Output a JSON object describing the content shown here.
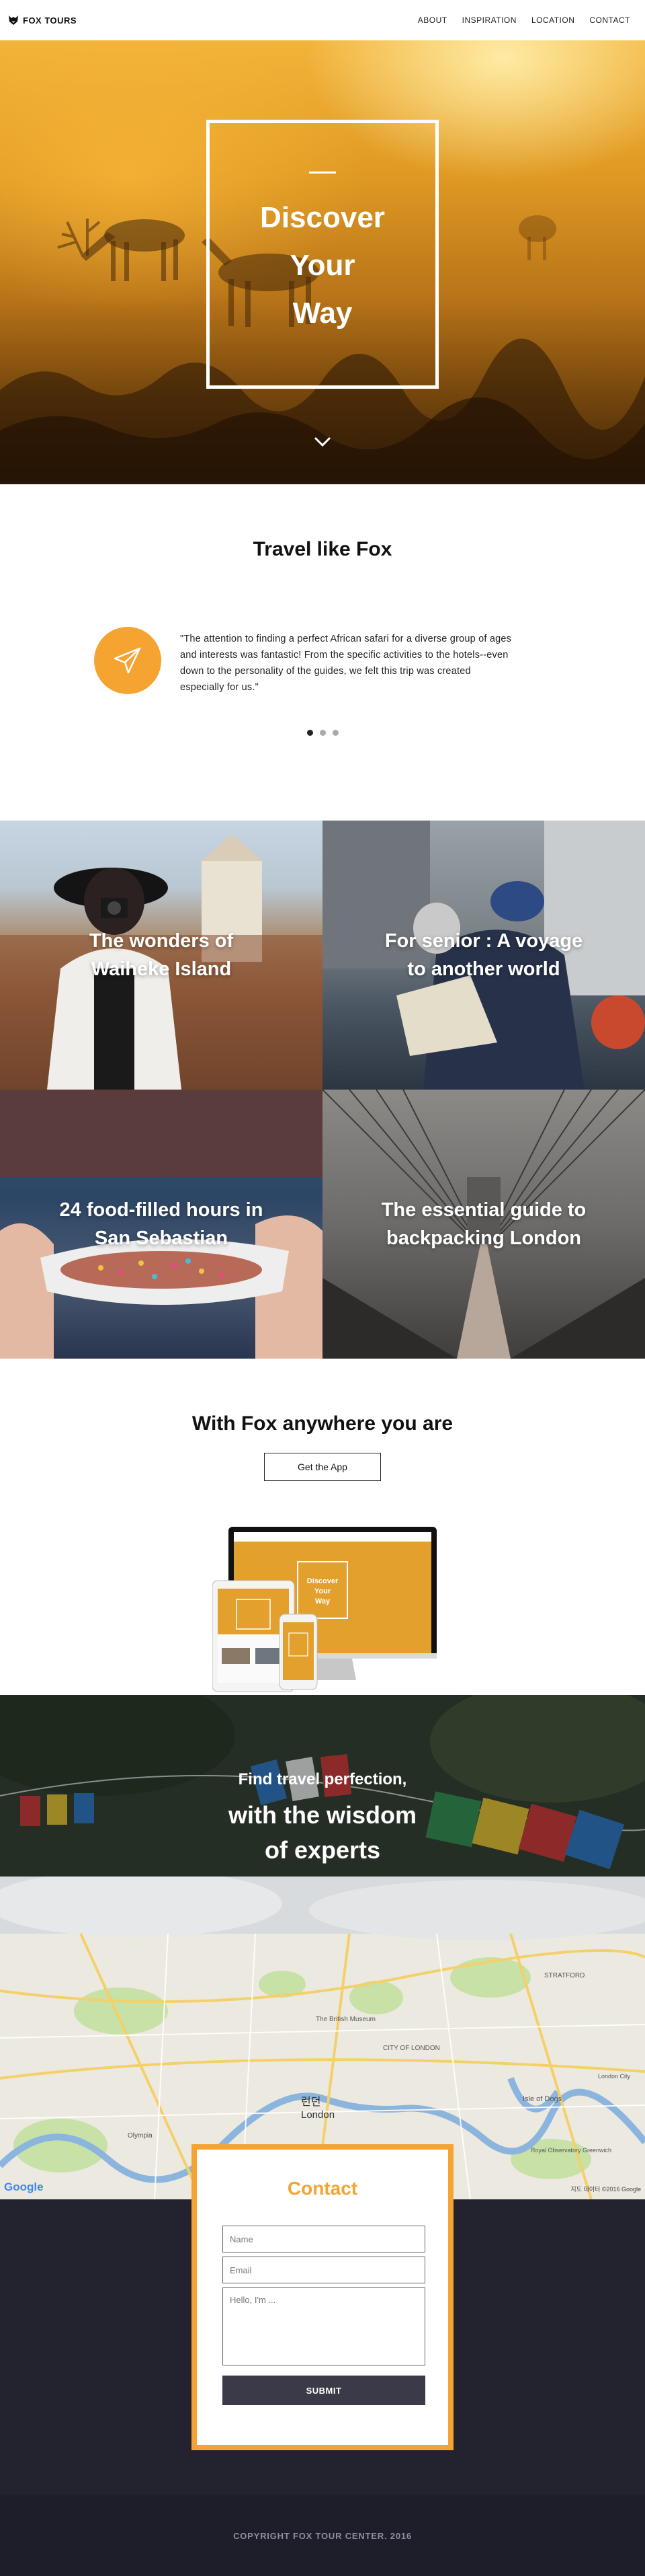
{
  "nav": {
    "brand": "FOX TOURS",
    "links": [
      "ABOUT",
      "INSPIRATION",
      "LOCATION",
      "CONTACT"
    ]
  },
  "hero": {
    "title": "Discover\nYour\nWay"
  },
  "travel": {
    "title": "Travel like Fox",
    "quote": "\"The attention to finding a perfect African safari for a diverse group of ages and interests was fantastic! From the specific activities to the hotels--even down to the personality of the guides, we felt this trip was created especially for us.\""
  },
  "grid": {
    "tiles": [
      "The wonders of Waiheke Island",
      "For senior : A voyage to another world",
      "24 food-filled hours in San Sebastian",
      "The essential guide to backpacking London"
    ]
  },
  "app": {
    "title": "With Fox anywhere you are",
    "button": "Get the App",
    "device_screen_text": "Discover\nYour\nWay"
  },
  "experts": {
    "subtitle": "Find travel perfection,",
    "title": "with the wisdom\nof experts"
  },
  "map": {
    "city_korean": "런던",
    "city": "London",
    "labels": [
      "STRATFORD",
      "The British Museum",
      "CITY OF LONDON",
      "Isle of Dogs",
      "Olympia",
      "Royal Observatory Greenwich",
      "London City"
    ],
    "google": "Google",
    "attribution": "지도 데이터 ©2016 Google"
  },
  "contact": {
    "title": "Contact",
    "name_placeholder": "Name",
    "email_placeholder": "Email",
    "message_placeholder": "Hello, I'm ...",
    "submit": "SUBMIT"
  },
  "footer": {
    "copyright": "COPYRIGHT FOX TOUR CENTER. 2016"
  },
  "colors": {
    "accent": "#f5a431",
    "dark": "#232330",
    "footer": "#1e1e2a"
  }
}
